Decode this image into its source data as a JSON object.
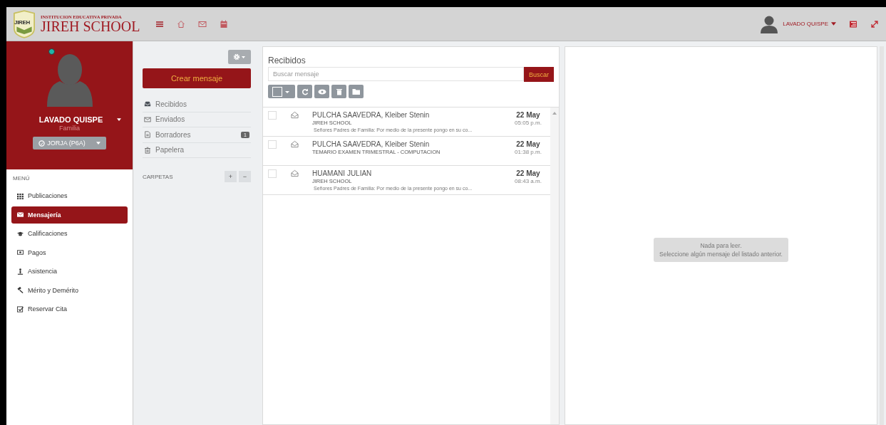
{
  "header": {
    "logo_badge": "JIREH",
    "logo_subtitle": "INSTITUCION EDUCATIVA PRIVADA",
    "logo_title": "JIREH SCHOOL",
    "user": "LAVADO QUISPE"
  },
  "profile": {
    "name": "LAVADO QUISPE",
    "role": "Familia",
    "student": "JORJA (P6A)",
    "online": true
  },
  "menu": {
    "title": "MENÚ",
    "items": [
      {
        "label": "Publicaciones",
        "kind": "grid",
        "selected": false
      },
      {
        "label": "Mensajería",
        "kind": "envelope",
        "selected": true
      },
      {
        "label": "Calificaciones",
        "kind": "cap",
        "selected": false
      },
      {
        "label": "Pagos",
        "kind": "money",
        "selected": false
      },
      {
        "label": "Asistencia",
        "kind": "person",
        "selected": false
      },
      {
        "label": "Mérito y Demérito",
        "kind": "gavel",
        "selected": false
      },
      {
        "label": "Reservar Cita",
        "kind": "check",
        "selected": false
      }
    ]
  },
  "folders": {
    "compose": "Crear mensaje",
    "items": [
      {
        "label": "Recibidos",
        "kind": "inbox"
      },
      {
        "label": "Enviados",
        "kind": "envelope"
      },
      {
        "label": "Borradores",
        "kind": "doc",
        "count": "1"
      },
      {
        "label": "Papelera",
        "kind": "trash"
      }
    ],
    "section": "CARPETAS",
    "add": "+",
    "remove": "−"
  },
  "inbox": {
    "title": "Recibidos",
    "search": {
      "placeholder": "Buscar mensaje",
      "button": "Buscar"
    },
    "messages": [
      {
        "sender": "PULCHA SAAVEDRA, Kleiber Stenin",
        "subject": "JIREH SCHOOL",
        "preview": "Señores Padres de Familia: Por medio de la presente pongo en su co...",
        "date": "22 May",
        "time": "05:05 p.m.",
        "checked": false
      },
      {
        "sender": "PULCHA SAAVEDRA, Kleiber Stenin",
        "subject": "TEMARIO EXAMEN TRIMESTRAL - COMPUTACION",
        "date": "22 May",
        "time": "01:38 p.m.",
        "checked": false
      },
      {
        "sender": "HUAMANI JULIAN",
        "subject": "JIREH SCHOOL",
        "preview": "Señores Padres de Familia: Por medio de la presente pongo en su co...",
        "date": "22 May",
        "time": "08:43 a.m.",
        "checked": false
      }
    ]
  },
  "reader": {
    "empty_lines": [
      "Nada para leer.",
      "Seleccione algún mensaje del listado anterior."
    ]
  }
}
